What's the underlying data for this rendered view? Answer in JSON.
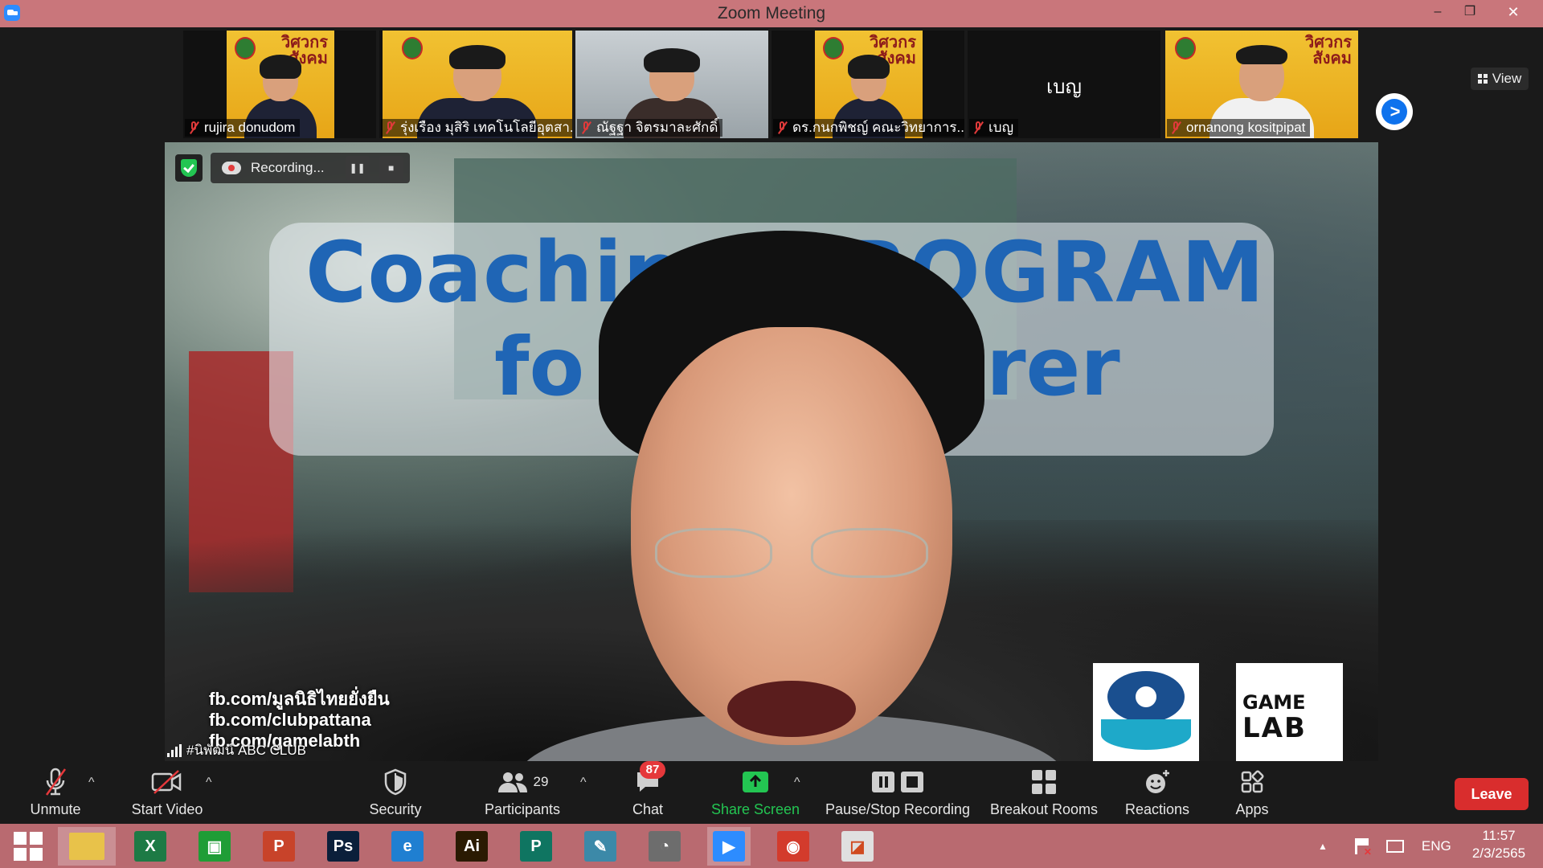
{
  "window": {
    "title": "Zoom Meeting",
    "min_label": "–",
    "max_label": "❐",
    "close_label": "✕"
  },
  "gallery": {
    "tiles": [
      {
        "name": "rujira donudom",
        "brand": "วิศวกร สังคม"
      },
      {
        "name": "รุ่งเรือง มุสิริ เทคโนโลยีอุตสา..."
      },
      {
        "name": "ณัฐฐา จิตรมาละศักดิ์"
      },
      {
        "name": "ดร.กนกพิชญ์ คณะวิทยาการ...",
        "brand": "วิศวกร สังคม"
      },
      {
        "name": "เบญ",
        "big": "เบญ"
      },
      {
        "name": "ornanong kositpipat",
        "brand": "วิศวกร สังคม"
      }
    ],
    "next_label": ">",
    "view_label": "View"
  },
  "main_video": {
    "headline_1": "Coachin",
    "headline_1b": "ROGRAM",
    "headline_2a": "fo",
    "headline_2b": "rer",
    "fb_lines": [
      "fb.com/มูลนิธิไทยยั่งยืน",
      "fb.com/clubpattana",
      "fb.com/gamelabth"
    ],
    "sponsor2_line1": "GAME",
    "sponsor2_line2": "LAB",
    "speaker_label": "#นิพัฒน์ ABC CLUB"
  },
  "recording": {
    "label": "Recording...",
    "pause": "❚❚",
    "stop": "■"
  },
  "toolbar": {
    "unmute": "Unmute",
    "start_video": "Start Video",
    "security": "Security",
    "participants": "Participants",
    "participants_count": "29",
    "chat": "Chat",
    "chat_badge": "87",
    "share_screen": "Share Screen",
    "pause_stop_recording": "Pause/Stop Recording",
    "breakout_rooms": "Breakout Rooms",
    "reactions": "Reactions",
    "apps": "Apps",
    "leave": "Leave",
    "caret": "^"
  },
  "taskbar": {
    "apps": [
      {
        "icon": "windows-start-icon"
      },
      {
        "icon": "file-explorer-icon"
      },
      {
        "icon": "excel-icon",
        "letter": "X",
        "color": "#1d7a45"
      },
      {
        "icon": "store-icon",
        "letter": "▣",
        "color": "#1f9d36"
      },
      {
        "icon": "powerpoint-icon",
        "letter": "P",
        "color": "#c8432a"
      },
      {
        "icon": "photoshop-icon",
        "letter": "Ps",
        "color": "#0b1f3a"
      },
      {
        "icon": "internet-explorer-icon",
        "letter": "e",
        "color": "#1f7fd1"
      },
      {
        "icon": "illustrator-icon",
        "letter": "Ai",
        "color": "#2a1a02"
      },
      {
        "icon": "publisher-icon",
        "letter": "P",
        "color": "#0f7561"
      },
      {
        "icon": "notepad-icon",
        "letter": "✎",
        "color": "#3c89a8"
      },
      {
        "icon": "photoscape-icon",
        "letter": "◔",
        "color": "#6d6d6d"
      },
      {
        "icon": "zoom-icon",
        "letter": "▶",
        "color": "#2d8cff"
      },
      {
        "icon": "chrome-icon",
        "letter": "◉",
        "color": "#d33b2c"
      },
      {
        "icon": "presentation-icon",
        "letter": "◪",
        "color": "#e0e0e0"
      }
    ],
    "language": "ENG",
    "time": "11:57",
    "date": "2/3/2565",
    "tray_arrow": "▲"
  },
  "colors": {
    "titlebar": "#c9767b",
    "taskbar": "#b96a70",
    "leave": "#d92d2d",
    "share_green": "#23c552",
    "zoom_blue": "#0e72ed"
  }
}
